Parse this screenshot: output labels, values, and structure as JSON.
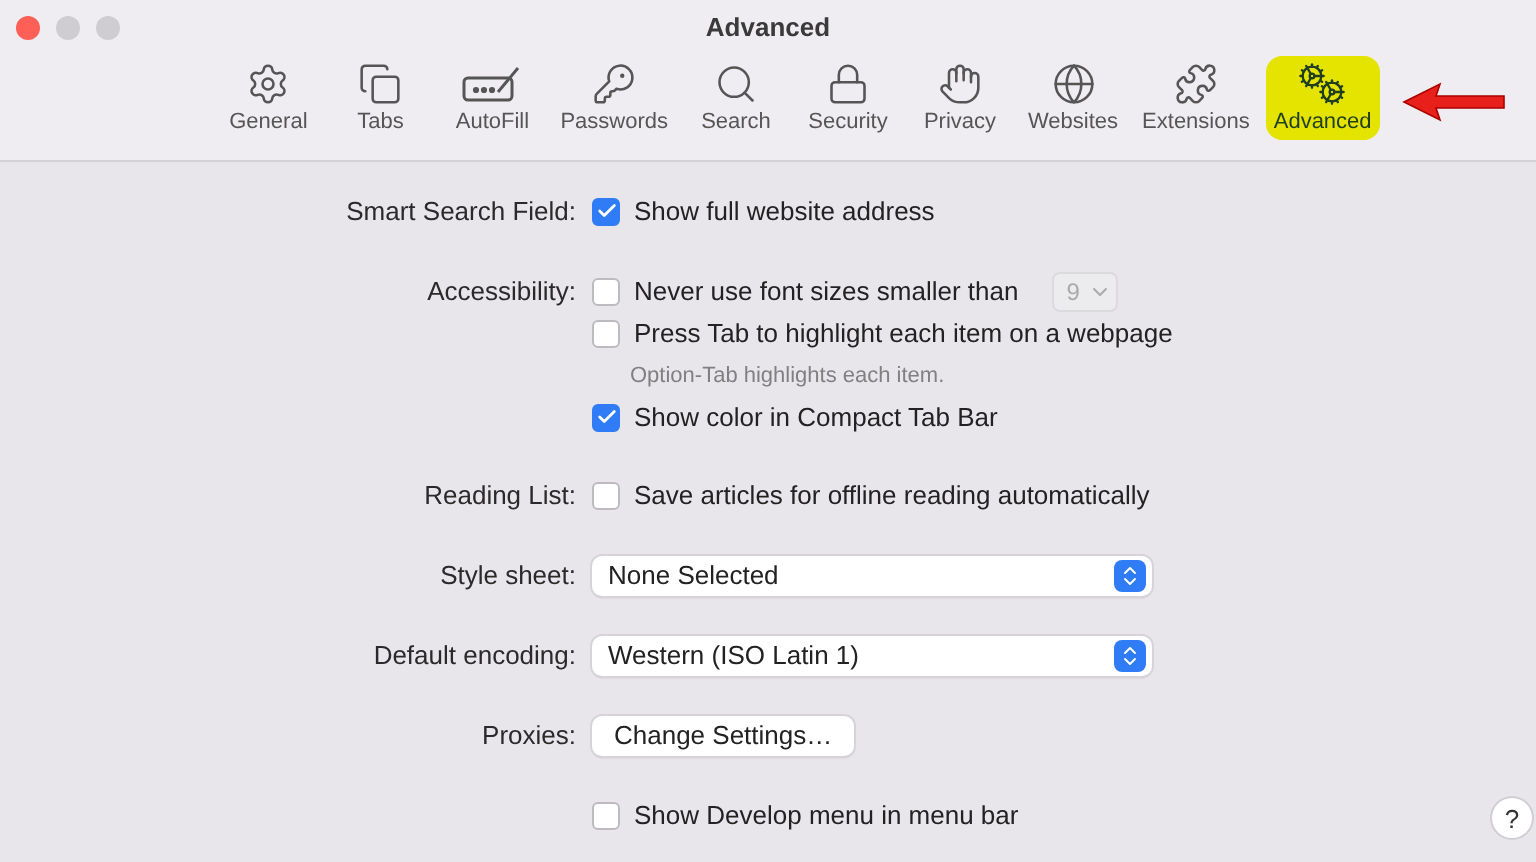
{
  "window": {
    "title": "Advanced"
  },
  "toolbar": [
    {
      "label": "General",
      "kind": "gear",
      "selected": false
    },
    {
      "label": "Tabs",
      "kind": "tabs",
      "selected": false
    },
    {
      "label": "AutoFill",
      "kind": "autofill",
      "selected": false
    },
    {
      "label": "Passwords",
      "kind": "key",
      "selected": false
    },
    {
      "label": "Search",
      "kind": "search",
      "selected": false
    },
    {
      "label": "Security",
      "kind": "lock",
      "selected": false
    },
    {
      "label": "Privacy",
      "kind": "hand",
      "selected": false
    },
    {
      "label": "Websites",
      "kind": "globe",
      "selected": false
    },
    {
      "label": "Extensions",
      "kind": "puzzle",
      "selected": false
    },
    {
      "label": "Advanced",
      "kind": "gears",
      "selected": true
    }
  ],
  "groups": [
    {
      "label": "Smart Search Field:",
      "rows": [
        {
          "kind": "checkbox",
          "text": "Show full website address",
          "checked": true
        }
      ]
    },
    {
      "label": "Accessibility:",
      "rows": [
        {
          "kind": "checkbox_select",
          "text": "Never use font sizes smaller than",
          "checked": false,
          "value": "9",
          "disabled": true
        },
        {
          "kind": "checkbox",
          "text": "Press Tab to highlight each item on a webpage",
          "checked": false
        },
        {
          "kind": "hint",
          "text": "Option-Tab highlights each item."
        },
        {
          "kind": "checkbox",
          "text": "Show color in Compact Tab Bar",
          "checked": true
        }
      ]
    },
    {
      "label": "Reading List:",
      "rows": [
        {
          "kind": "checkbox",
          "text": "Save articles for offline reading automatically",
          "checked": false
        }
      ]
    },
    {
      "label": "Style sheet:",
      "rows": [
        {
          "kind": "select",
          "value": "None Selected"
        }
      ]
    },
    {
      "label": "Default encoding:",
      "rows": [
        {
          "kind": "select",
          "value": "Western (ISO Latin 1)"
        }
      ]
    },
    {
      "label": "Proxies:",
      "rows": [
        {
          "kind": "button",
          "text": "Change Settings…"
        }
      ]
    },
    {
      "rows": [
        {
          "kind": "checkbox",
          "text": "Show Develop menu in menu bar",
          "checked": false
        }
      ]
    }
  ],
  "help_button": "?"
}
